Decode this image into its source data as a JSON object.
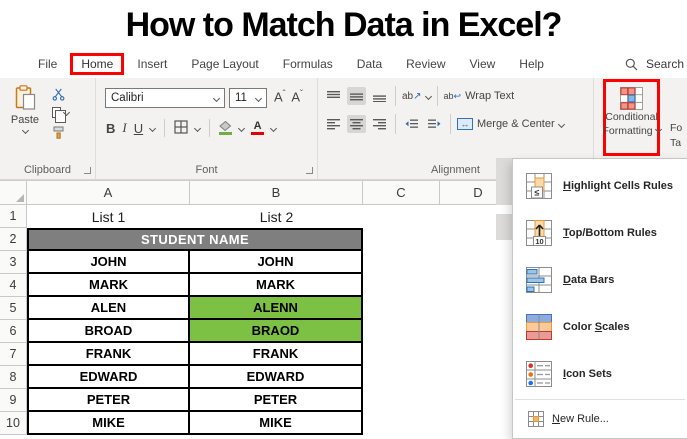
{
  "title": "How to Match Data in Excel?",
  "ribbon": {
    "tabs": [
      "File",
      "Home",
      "Insert",
      "Page Layout",
      "Formulas",
      "Data",
      "Review",
      "View",
      "Help"
    ],
    "search_label": "Search",
    "clipboard": {
      "label": "Clipboard",
      "paste_label": "Paste"
    },
    "font": {
      "label": "Font",
      "family": "Calibri",
      "size": "11",
      "bold_label": "B",
      "italic_label": "I",
      "underline_label": "U",
      "grow_label": "A",
      "shrink_label": "A",
      "font_color_label": "A"
    },
    "alignment": {
      "label": "Alignment",
      "orientation_label": "ab",
      "wrap_icon_label": "ab",
      "wrap_label": "Wrap Text",
      "merge_label": "Merge & Center"
    },
    "styles": {
      "conditional_line1": "Conditional",
      "conditional_line2": "Formatting",
      "clipped_next_line1": "Fo",
      "clipped_next_line2": "Ta"
    }
  },
  "menu": {
    "items": [
      {
        "pre": "",
        "u": "H",
        "post": "ighlight Cells Rules"
      },
      {
        "pre": "",
        "u": "T",
        "post": "op/Bottom Rules"
      },
      {
        "pre": "",
        "u": "D",
        "post": "ata Bars"
      },
      {
        "pre": "Color ",
        "u": "S",
        "post": "cales"
      },
      {
        "pre": "",
        "u": "I",
        "post": "con Sets"
      },
      {
        "pre": "",
        "u": "N",
        "post": "ew Rule..."
      }
    ]
  },
  "sheet": {
    "columns": [
      "A",
      "B",
      "C",
      "D"
    ],
    "rows": {
      "r1": {
        "num": "1",
        "a": "List 1",
        "b": "List 2"
      },
      "r2": {
        "num": "2",
        "banner": "STUDENT NAME"
      },
      "r3": {
        "num": "3",
        "a": "JOHN",
        "b": "JOHN"
      },
      "r4": {
        "num": "4",
        "a": "MARK",
        "b": "MARK"
      },
      "r5": {
        "num": "5",
        "a": "ALEN",
        "b": "ALENN"
      },
      "r6": {
        "num": "6",
        "a": "BROAD",
        "b": "BRAOD"
      },
      "r7": {
        "num": "7",
        "a": "FRANK",
        "b": "FRANK"
      },
      "r8": {
        "num": "8",
        "a": "EDWARD",
        "b": "EDWARD"
      },
      "r9": {
        "num": "9",
        "a": "PETER",
        "b": "PETER"
      },
      "r10": {
        "num": "10",
        "a": "MIKE",
        "b": "MIKE"
      }
    }
  },
  "colors": {
    "highlight_green": "#7CC143",
    "banner_gray": "#7F7F7F",
    "annotation_red": "#FF0000"
  }
}
